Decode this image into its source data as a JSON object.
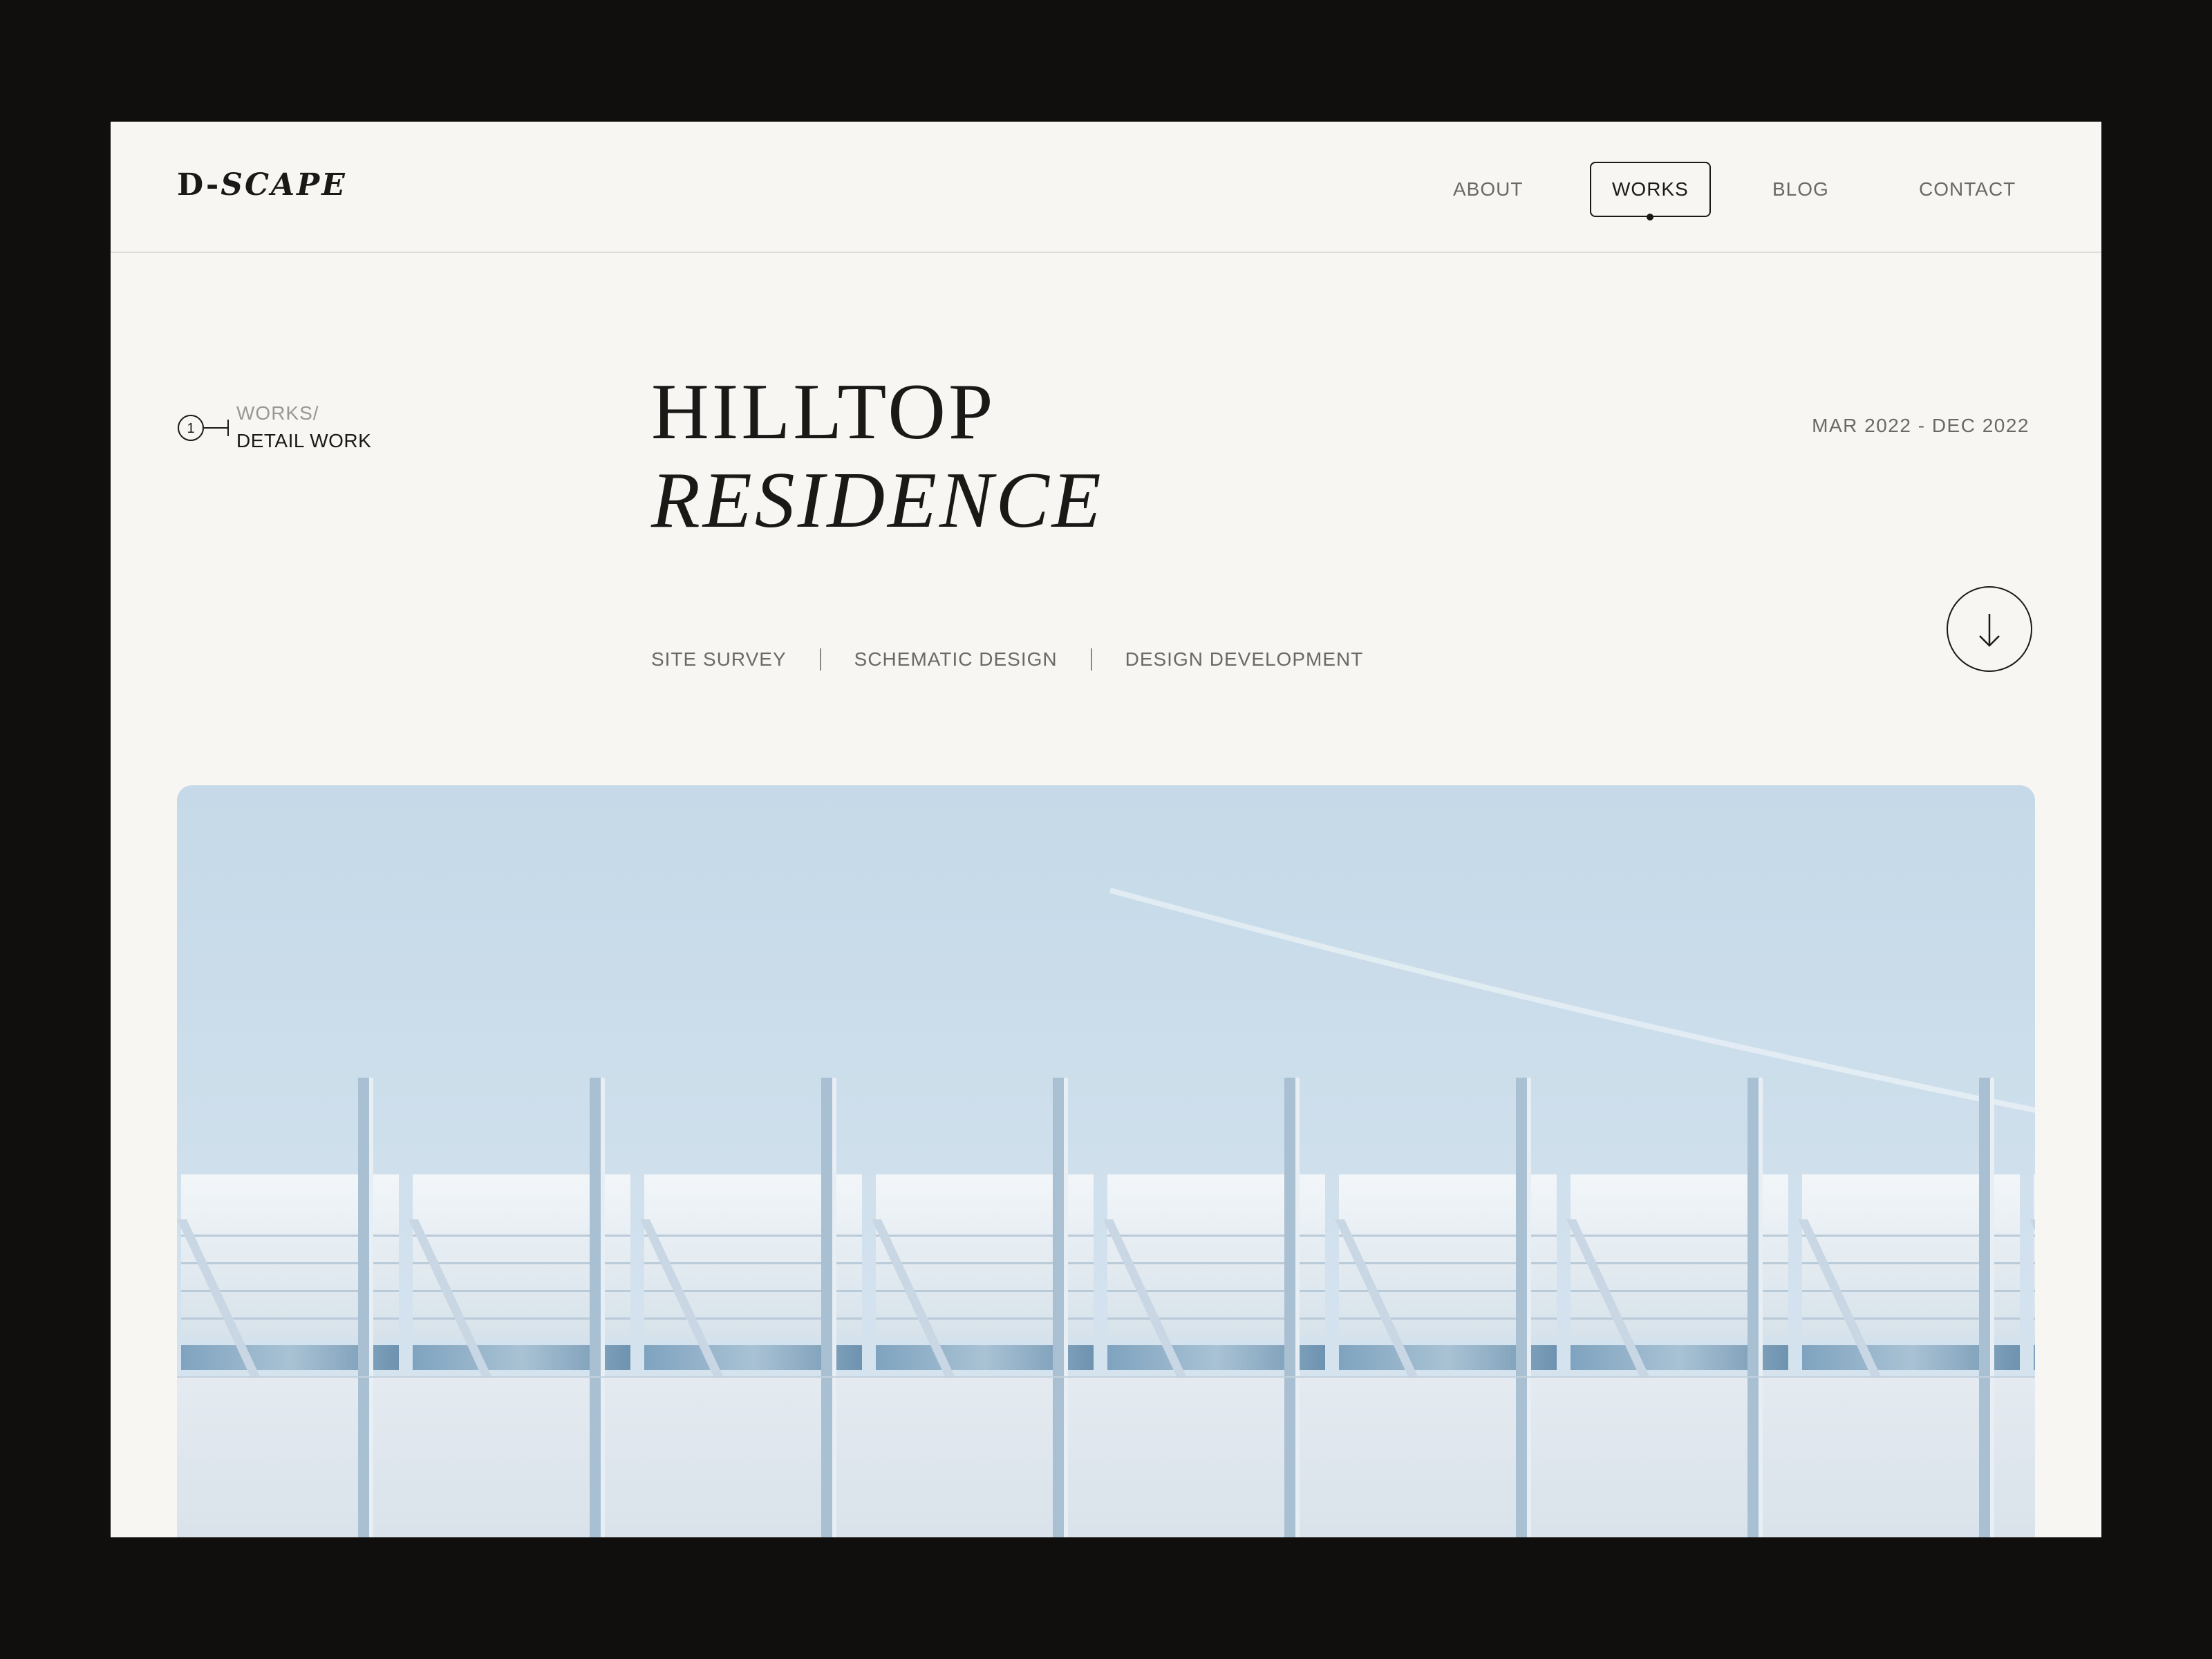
{
  "brand": {
    "logo_prefix": "D-",
    "logo_suffix": "SCAPE"
  },
  "nav": {
    "items": [
      {
        "label": "ABOUT",
        "active": false
      },
      {
        "label": "WORKS",
        "active": true
      },
      {
        "label": "BLOG",
        "active": false
      },
      {
        "label": "CONTACT",
        "active": false
      }
    ]
  },
  "breadcrumb": {
    "index": "1",
    "parent": "WORKS/",
    "current": "DETAIL WORK"
  },
  "project": {
    "title_line1": "HILLTOP",
    "title_line2": "RESIDENCE",
    "date_range": "MAR 2022 - DEC 2022",
    "phases": [
      "SITE SURVEY",
      "SCHEMATIC DESIGN",
      "DESIGN DEVELOPMENT"
    ]
  },
  "icons": {
    "scroll": "arrow-down-icon",
    "breadcrumb": "step-marker-icon"
  },
  "colors": {
    "page_background": "#100f0d",
    "surface": "#f7f6f3",
    "text_primary": "#1a1917",
    "text_secondary": "#6a6966",
    "sky": "#c9dce9"
  }
}
